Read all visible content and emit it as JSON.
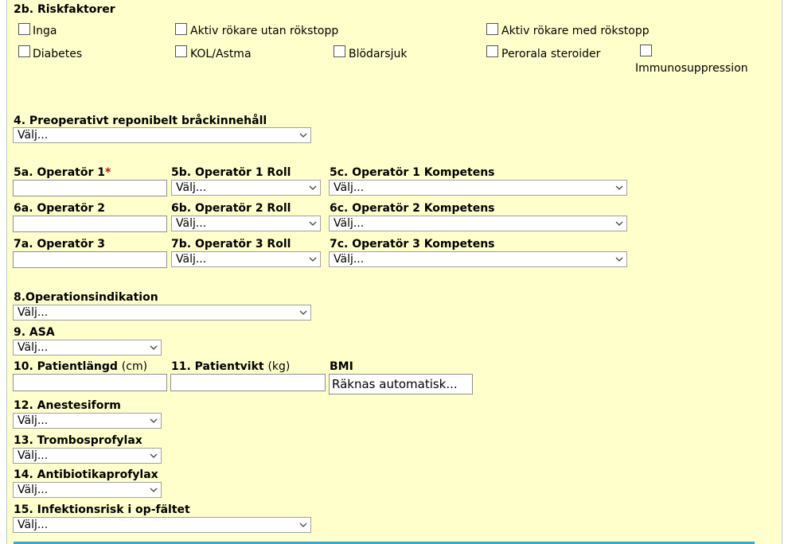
{
  "section2b": {
    "title": "2b. Riskfaktorer",
    "checkboxes": [
      "Inga",
      "Aktiv rökare utan rökstopp",
      "Aktiv rökare med rökstopp",
      "Diabetes",
      "KOL/Astma",
      "Blödarsjuk",
      "Perorala steroider",
      "Immunosuppression"
    ]
  },
  "q4": {
    "label": "4. Preoperativt reponibelt bråckinnehåll",
    "value": "Välj..."
  },
  "operators": [
    {
      "name_label": "5a. Operatör 1",
      "required": "*",
      "role_label": "5b. Operatör 1 Roll",
      "role_value": "Välj...",
      "comp_label": "5c. Operatör 1 Kompetens",
      "comp_value": "Välj..."
    },
    {
      "name_label": "6a. Operatör 2",
      "role_label": "6b. Operatör 2 Roll",
      "role_value": "Välj...",
      "comp_label": "6c. Operatör 2 Kompetens",
      "comp_value": "Välj..."
    },
    {
      "name_label": "7a. Operatör 3",
      "role_label": "7b. Operatör 3 Roll",
      "role_value": "Välj...",
      "comp_label": "7c. Operatör 3 Kompetens",
      "comp_value": "Välj..."
    }
  ],
  "q8": {
    "label": "8.Operationsindikation",
    "value": "Välj..."
  },
  "q9": {
    "label": "9. ASA",
    "value": "Välj..."
  },
  "q10": {
    "label": "10. Patientlängd",
    "unit": "(cm)"
  },
  "q11": {
    "label": "11. Patientvikt",
    "unit": "(kg)"
  },
  "bmi": {
    "label": "BMI",
    "value": "Räknas automatisk..."
  },
  "q12": {
    "label": "12. Anestesiform",
    "value": "Välj..."
  },
  "q13": {
    "label": "13. Trombosprofylax",
    "value": "Välj..."
  },
  "q14": {
    "label": "14. Antibiotikaprofylax",
    "value": "Välj..."
  },
  "q15": {
    "label": "15. Infektionsrisk i op-fältet",
    "value": "Välj..."
  }
}
